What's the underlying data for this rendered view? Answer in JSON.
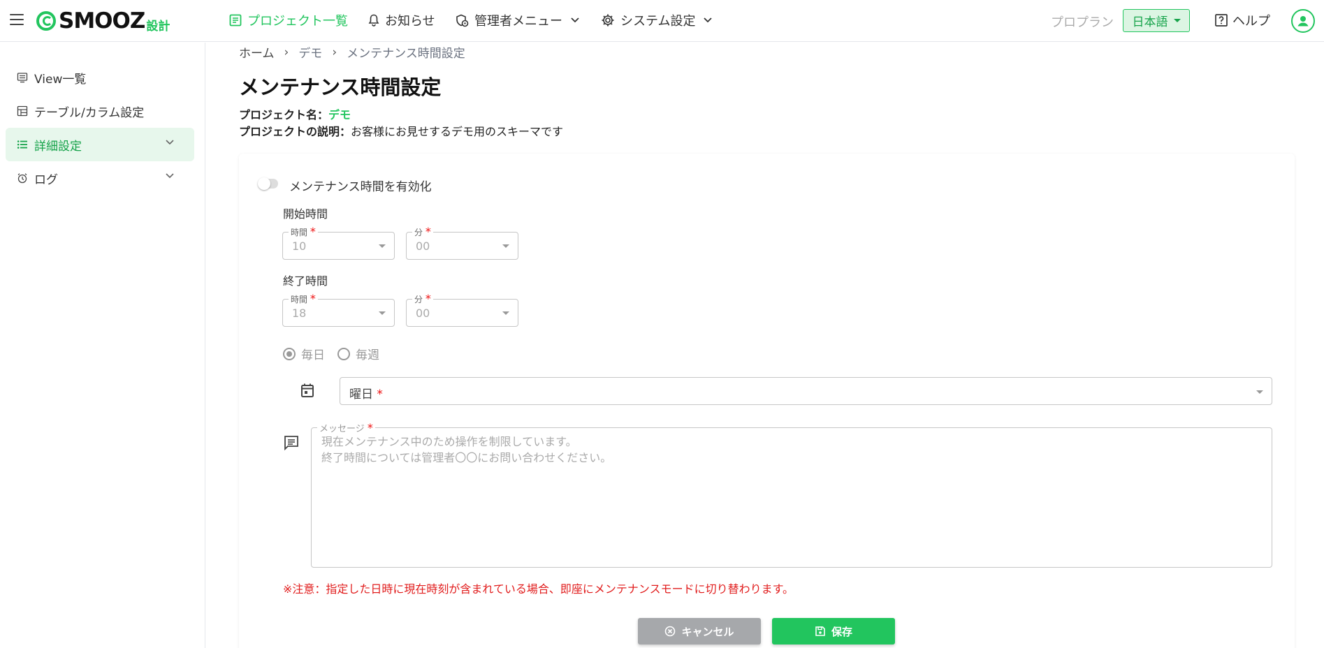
{
  "header": {
    "logo_text": "SMOOZ",
    "logo_sub": "設計",
    "nav": [
      {
        "label": "プロジェクト一覧"
      },
      {
        "label": "お知らせ"
      },
      {
        "label": "管理者メニュー"
      },
      {
        "label": "システム設定"
      }
    ],
    "plan_label": "プロプラン",
    "language": "日本語",
    "help_label": "ヘルプ"
  },
  "sidebar": {
    "items": [
      {
        "label": "View一覧"
      },
      {
        "label": "テーブル/カラム設定"
      },
      {
        "label": "詳細設定"
      },
      {
        "label": "ログ"
      }
    ]
  },
  "breadcrumb": {
    "items": [
      "ホーム",
      "デモ",
      "メンテナンス時間設定"
    ],
    "separator": "›"
  },
  "page": {
    "title": "メンテナンス時間設定",
    "project_name_label": "プロジェクト名：",
    "project_name": "デモ",
    "project_desc_label": "プロジェクトの説明：",
    "project_desc": "お客様にお見せするデモ用のスキーマです"
  },
  "form": {
    "toggle_label": "メンテナンス時間を有効化",
    "toggle_on": false,
    "start_label": "開始時間",
    "end_label": "終了時間",
    "hour_label": "時間",
    "minute_label": "分",
    "required_mark": "*",
    "start_hour": "10",
    "start_minute": "00",
    "end_hour": "18",
    "end_minute": "00",
    "freq_daily": "毎日",
    "freq_weekly": "毎週",
    "freq_selected": "毎日",
    "weekday_placeholder": "曜日",
    "message_label": "メッセージ",
    "message_text": "現在メンテナンス中のため操作を制限しています。\n終了時間については管理者〇〇にお問い合わせください。",
    "warning": "※注意：指定した日時に現在時刻が含まれている場合、即座にメンテナンスモードに切り替わります。"
  },
  "buttons": {
    "cancel": "キャンセル",
    "save": "保存"
  },
  "colors": {
    "accent": "#22c55e",
    "warning": "#e11d1d",
    "cancel_bg": "#a6a8ab"
  }
}
